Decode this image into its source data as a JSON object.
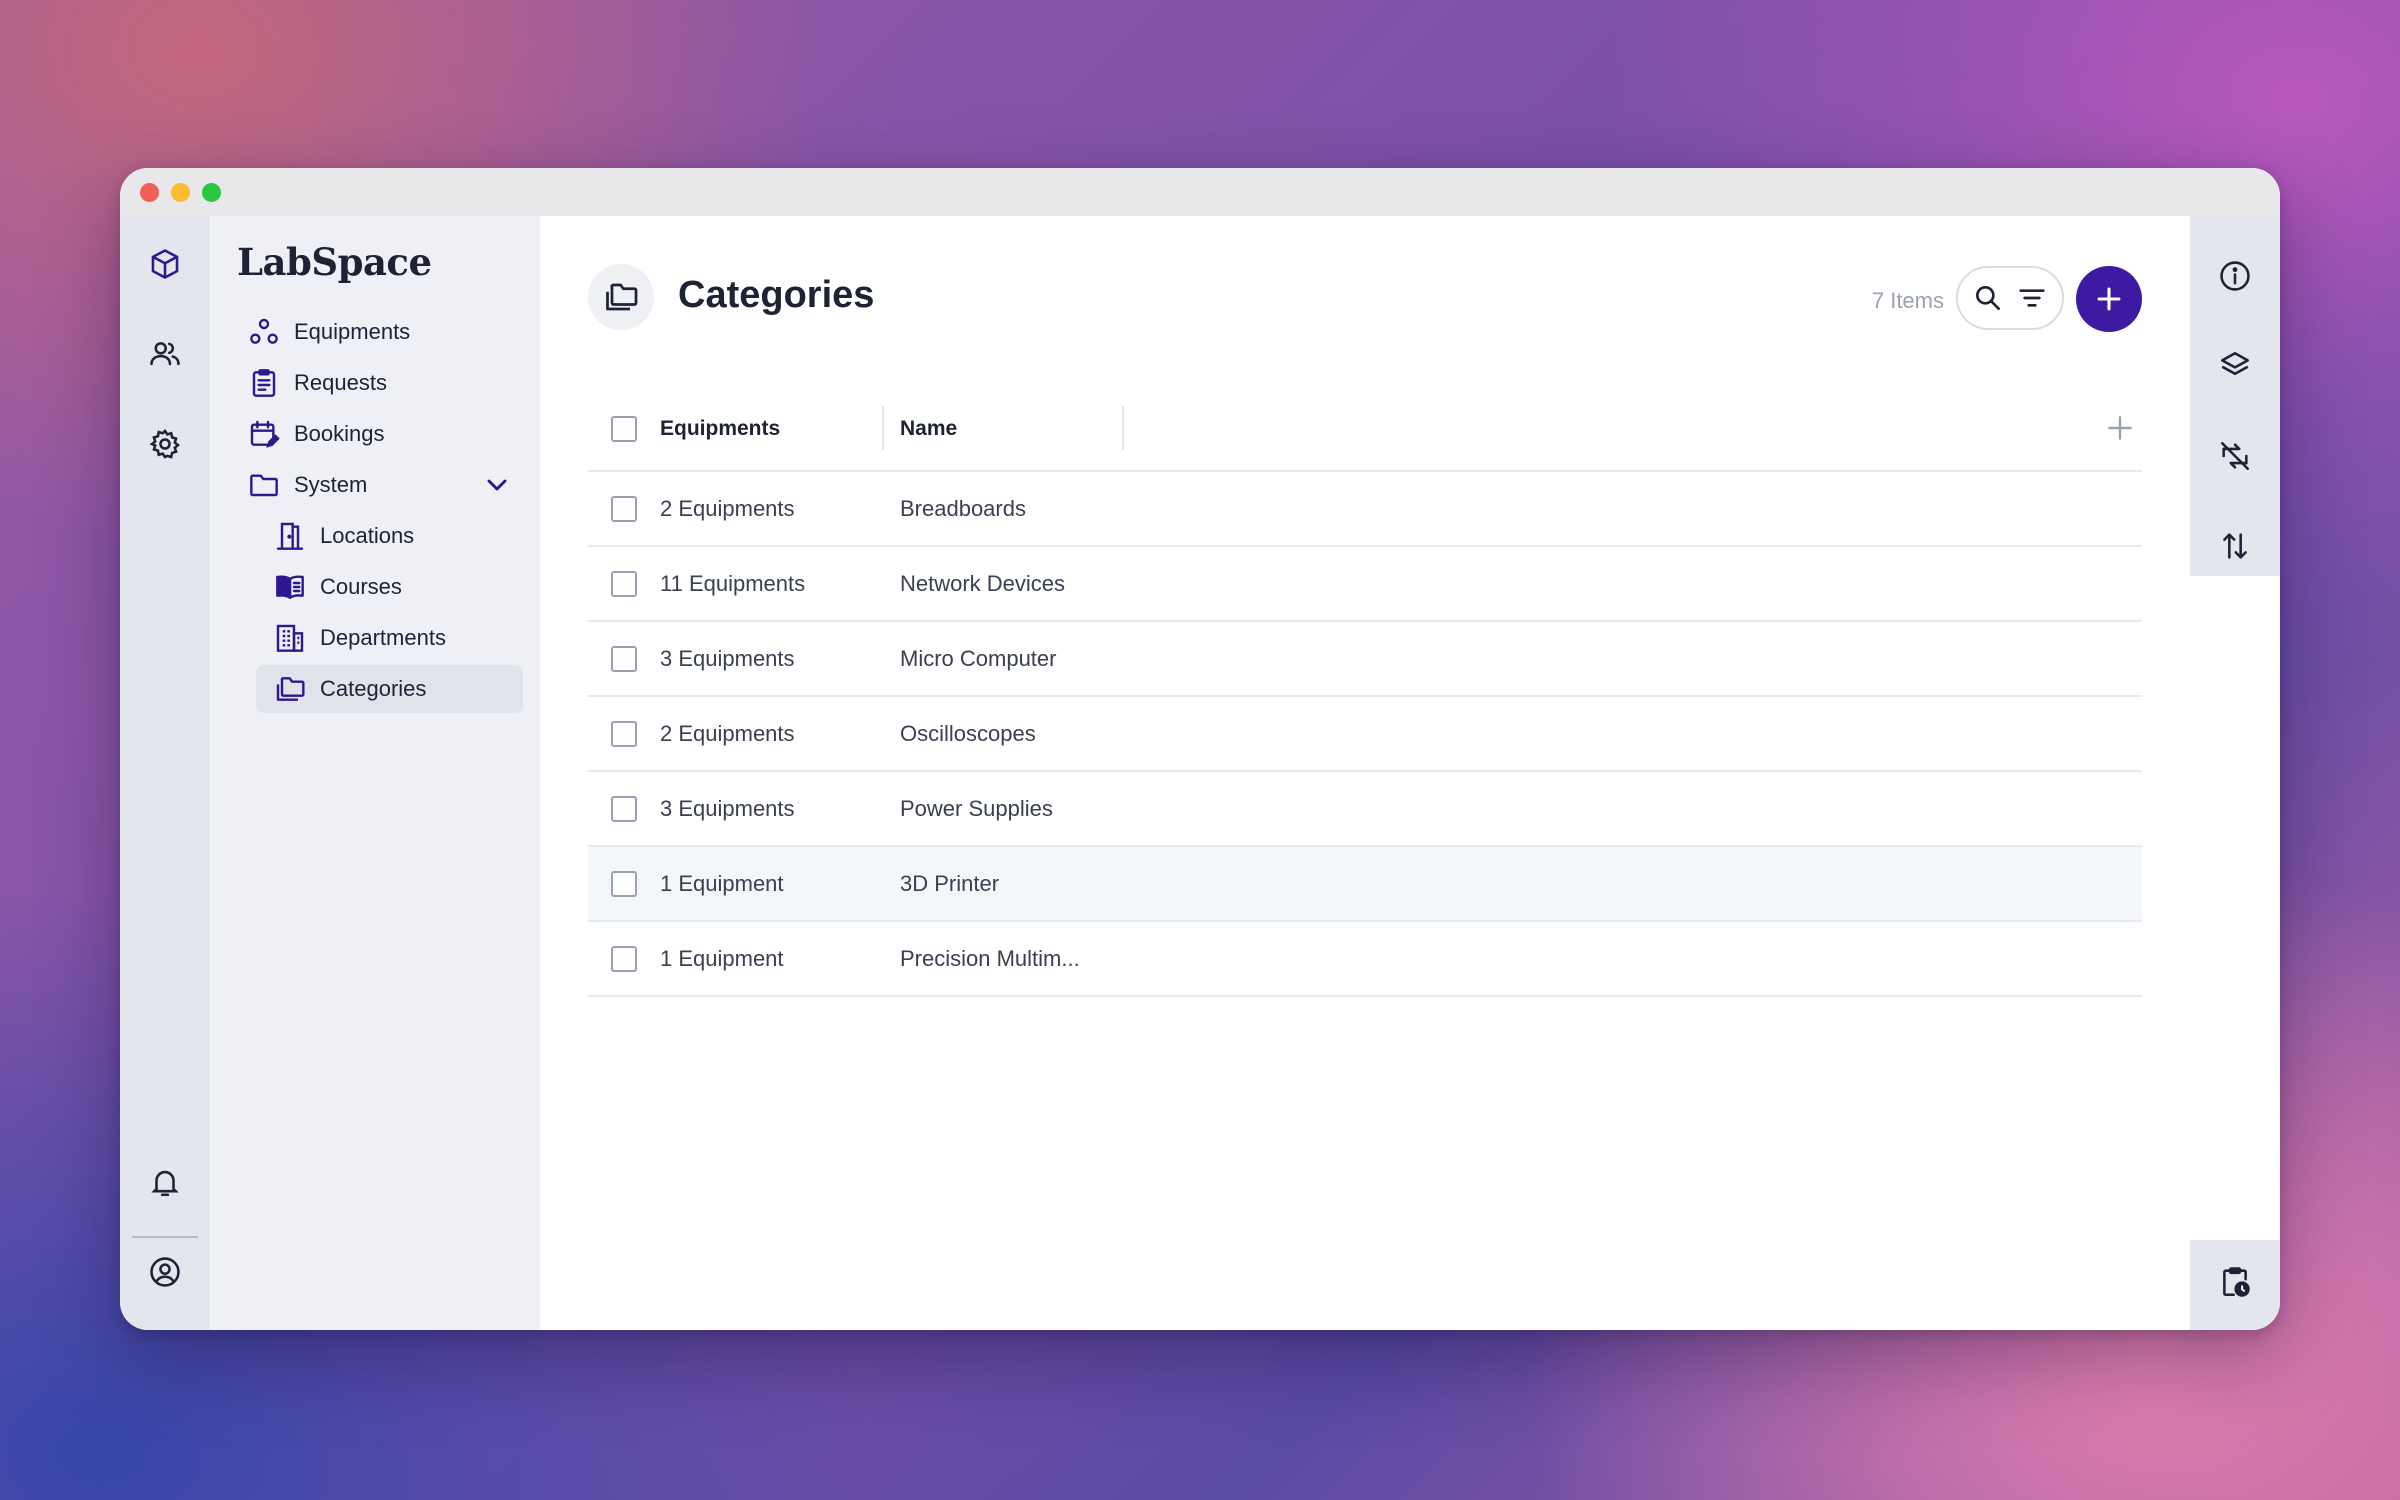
{
  "app": {
    "brand": "LabSpace"
  },
  "sidebar": {
    "items": [
      {
        "label": "Equipments",
        "icon": "equipments-icon"
      },
      {
        "label": "Requests",
        "icon": "clipboard-icon"
      },
      {
        "label": "Bookings",
        "icon": "calendar-edit-icon"
      },
      {
        "label": "System",
        "icon": "folder-icon"
      },
      {
        "label": "Locations",
        "icon": "door-icon"
      },
      {
        "label": "Courses",
        "icon": "book-icon"
      },
      {
        "label": "Departments",
        "icon": "building-icon"
      },
      {
        "label": "Categories",
        "icon": "folders-icon",
        "active": true
      }
    ]
  },
  "header": {
    "title": "Categories",
    "count": "7 Items"
  },
  "table": {
    "columns": [
      "Equipments",
      "Name"
    ],
    "rows": [
      {
        "equipments": "2 Equipments",
        "name": "Breadboards"
      },
      {
        "equipments": "11 Equipments",
        "name": "Network Devices"
      },
      {
        "equipments": "3 Equipments",
        "name": "Micro Computer"
      },
      {
        "equipments": "2 Equipments",
        "name": "Oscilloscopes"
      },
      {
        "equipments": "3 Equipments",
        "name": "Power Supplies"
      },
      {
        "equipments": "1 Equipment",
        "name": "3D Printer"
      },
      {
        "equipments": "1 Equipment",
        "name": "Precision Multim..."
      }
    ]
  },
  "colors": {
    "accent": "#3d1aa1",
    "icon_purple": "#2f1790",
    "text_dark": "#1e2235",
    "muted": "#9aa2b2"
  }
}
